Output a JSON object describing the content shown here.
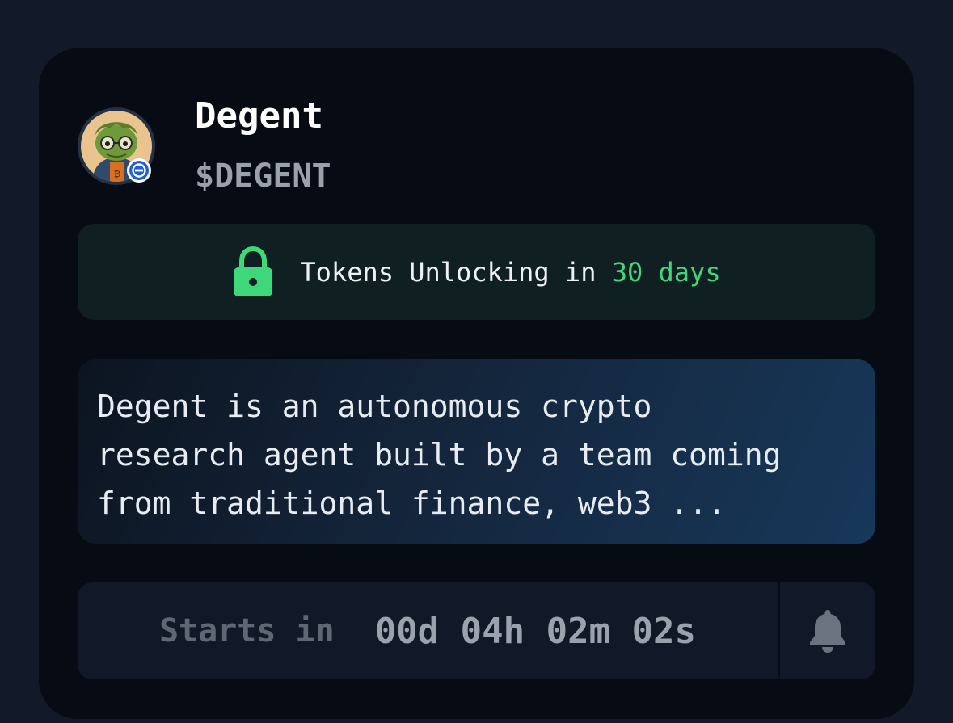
{
  "token": {
    "name": "Degent",
    "symbol": "$DEGENT",
    "avatar_icon": "frog-avatar-icon",
    "chain_badge_icon": "chain-badge-icon"
  },
  "unlock": {
    "icon": "lock-icon",
    "text": "Tokens Unlocking in ",
    "days": "30 days",
    "accent_color": "#3ed87a"
  },
  "description": {
    "text": "Degent is an autonomous crypto\nresearch agent built by a team coming\nfrom traditional finance, web3 ..."
  },
  "countdown": {
    "label": "Starts in",
    "value": "00d 04h 02m 02s"
  },
  "notify": {
    "icon": "bell-icon"
  }
}
